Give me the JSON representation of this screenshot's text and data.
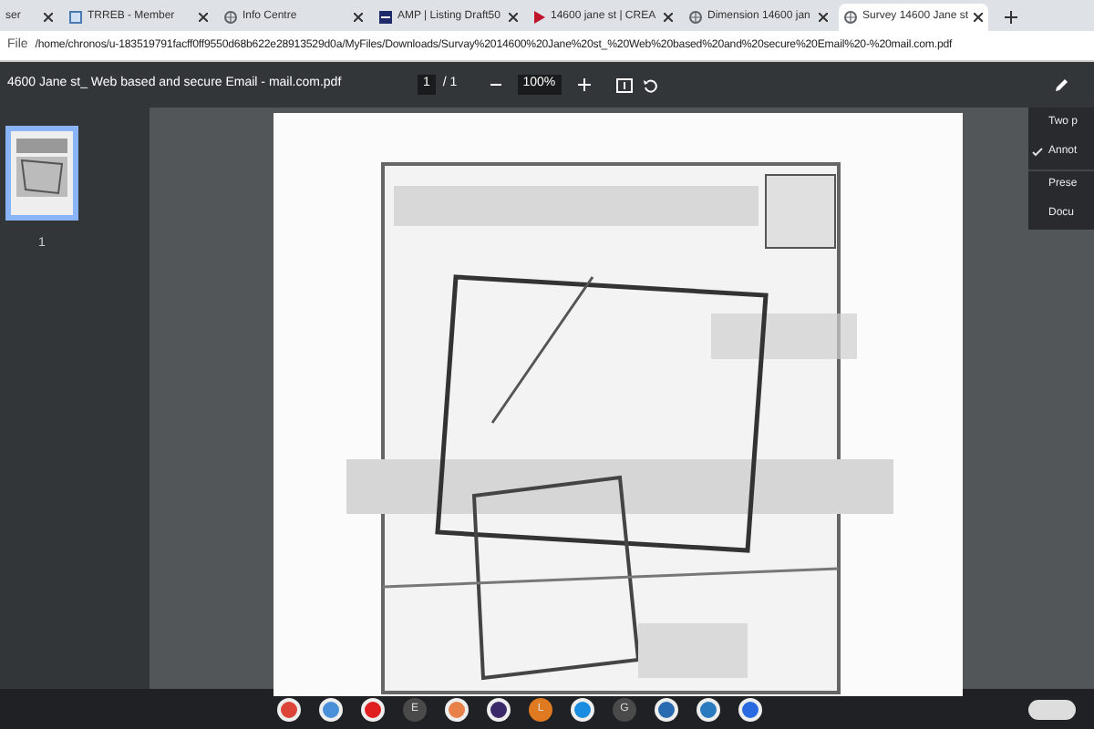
{
  "tabs": [
    {
      "title": "ser",
      "selected": false
    },
    {
      "title": "TRREB - Member",
      "selected": false
    },
    {
      "title": "Info Centre",
      "selected": false
    },
    {
      "title": "AMP | Listing Draft50",
      "selected": false
    },
    {
      "title": "14600 jane st | CREA",
      "selected": false
    },
    {
      "title": "Dimension 14600 jan",
      "selected": false
    },
    {
      "title": "Survey 14600 Jane st",
      "selected": true
    }
  ],
  "address_bar": {
    "scheme": "File",
    "url": "/home/chronos/u-183519791facff0ff9550d68b622e28913529d0a/MyFiles/Downloads/Survay%2014600%20Jane%20st_%20Web%20based%20and%20secure%20Email%20-%20mail.com.pdf"
  },
  "pdf_toolbar": {
    "filename": "4600 Jane st_ Web based and secure Email - mail.com.pdf",
    "page": "1",
    "page_total": "/ 1",
    "zoom": "100%"
  },
  "thumbnails": [
    {
      "label": "1",
      "selected": true
    }
  ],
  "menu": [
    {
      "label": "Two p",
      "checked": false
    },
    {
      "label": "Annot",
      "checked": true
    },
    {
      "label": "Prese",
      "checked": false
    },
    {
      "label": "Docu",
      "checked": false
    }
  ],
  "shelf": [
    {
      "kind": "icon",
      "color": "#db4437"
    },
    {
      "kind": "icon",
      "color": "#4a90d9"
    },
    {
      "kind": "icon",
      "color": "#e02020"
    },
    {
      "kind": "letter",
      "label": "E",
      "color": "#4a4a4a"
    },
    {
      "kind": "icon",
      "color": "#e8804a"
    },
    {
      "kind": "icon",
      "color": "#3a2a6a"
    },
    {
      "kind": "letter",
      "label": "L",
      "color": "#e07a20"
    },
    {
      "kind": "icon",
      "color": "#1a8de0"
    },
    {
      "kind": "letter",
      "label": "G",
      "color": "#4a4a4a"
    },
    {
      "kind": "icon",
      "color": "#2a6ab0"
    },
    {
      "kind": "icon",
      "color": "#2a7ac0"
    },
    {
      "kind": "icon",
      "color": "#2a6ae0"
    }
  ]
}
